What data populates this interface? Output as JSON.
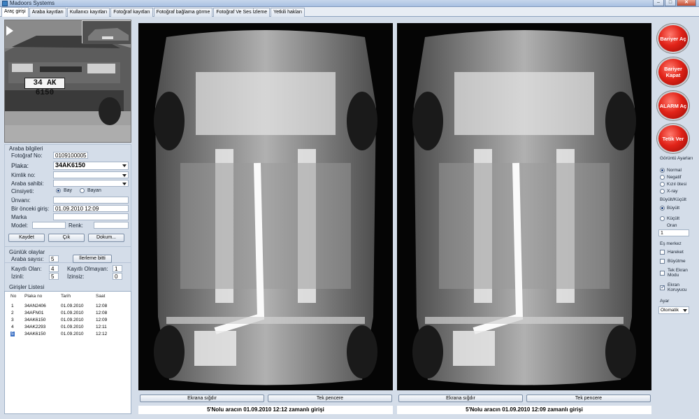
{
  "window": {
    "title": "Madoors Systems",
    "minimize": "–",
    "maximize": "□",
    "close": "✕"
  },
  "tabs": [
    "Araç girişi",
    "Araba kayıtları",
    "Kullanıcı kayıtları",
    "Fotoğraf kayıtları",
    "Fotoğraf bağlama görme",
    "Fotoğraf  Ve Ses İzleme",
    "Yetkili hakları"
  ],
  "camera": {
    "plate_text": "34 AK 6150"
  },
  "car_info": {
    "section_title": "Araba bilgileri",
    "photo_no_label": "Fotoğraf No:",
    "photo_no_value": "0109100005",
    "plate_label": "Plaka:",
    "plate_value": "34AK6150",
    "id_label": "Kimlik no:",
    "id_value": "",
    "owner_label": "Araba sahibi:",
    "owner_value": "",
    "gender_label": "Cinsiyeti:",
    "gender_options": [
      "Bay",
      "Bayan"
    ],
    "gender_selected": "Bay",
    "title_label": "Ünvanı:",
    "title_value": "",
    "prev_entry_label": "Bir önceki giriş:",
    "prev_entry_value": "01.09.2010 12:09",
    "brand_label": "Marka",
    "brand_value": "",
    "model_label": "Model:",
    "model_value": "",
    "color_label": "Renk:",
    "color_value": "",
    "save_label": "Kaydet",
    "exit_label": "Çık",
    "doc_label": "Dokum..."
  },
  "daily": {
    "section_title": "Günlük olaylar",
    "car_count_label": "Araba sayısı:",
    "car_count_value": "5",
    "process_done_label": "İlerleme bitti",
    "registered_label": "Kayıtlı Olan:",
    "registered_value": "4",
    "unregistered_label": "Kayıtlı Olmayan:",
    "unregistered_value": "1",
    "permitted_label": "İzinli:",
    "permitted_value": "5",
    "unpermitted_label": "İzinsiz:",
    "unpermitted_value": "0"
  },
  "entries": {
    "section_title": "Girişler Listesi",
    "columns": [
      "No",
      "Plaka no",
      "Tarih",
      "Saat"
    ],
    "rows": [
      [
        "1",
        "34AN2406",
        "01.09.2010",
        "12:08"
      ],
      [
        "2",
        "34AFN01",
        "01.09.2010",
        "12:08"
      ],
      [
        "3",
        "34AK6150",
        "01.09.2010",
        "12:09"
      ],
      [
        "4",
        "34AK2293",
        "01.09.2010",
        "12:11"
      ],
      [
        "5",
        "34AK6150",
        "01.09.2010",
        "12:12"
      ]
    ],
    "selected_row": 4
  },
  "view_left": {
    "fit_label": "Ekrana sığdır",
    "single_label": "Tek pencere",
    "caption": "5'Nolu aracın 01.09.2010 12:12 zamanlı girişi"
  },
  "view_right": {
    "fit_label": "Ekrana sığdır",
    "single_label": "Tek pencere",
    "caption": "5'Nolu aracın 01.09.2010 12:09 zamanlı girişi"
  },
  "controls": {
    "barrier_open": "Bariyer Aç",
    "barrier_close": "Bariyer Kapat",
    "alarm_open": "ALARM Aç",
    "trigger": "Tetik Ver",
    "view_settings_label": "Görüntü Ayarları",
    "view_modes": [
      "Normal",
      "Negatif",
      "Kızıl ötesi",
      "X-ray"
    ],
    "view_mode_selected": "Normal",
    "zoom_label": "Büyült/Küçült",
    "zoom_options": [
      "Büyült",
      "Küçült"
    ],
    "zoom_selected": "Büyült",
    "ratio_label": "Oran",
    "ratio_value": "1",
    "center_label": "Eş merkez",
    "checks": [
      {
        "label": "Hareket",
        "checked": false
      },
      {
        "label": "Büyütme",
        "checked": false
      },
      {
        "label": "Tek Ekran Modu",
        "checked": false
      },
      {
        "label": "Ekran Koruyucu",
        "checked": true
      }
    ],
    "setting_label": "Ayar",
    "setting_value": "Otomatik"
  }
}
